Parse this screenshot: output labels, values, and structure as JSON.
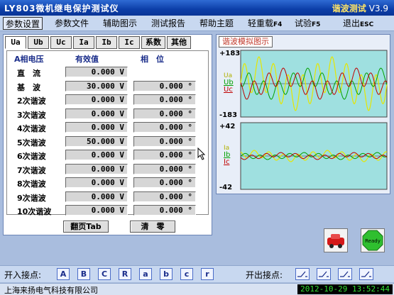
{
  "title": "LY803微机继电保护测试仪",
  "mode": "谐波测试",
  "version": "V3.9",
  "menu": [
    {
      "label": "参数设置",
      "key": ""
    },
    {
      "label": "参数文件",
      "key": ""
    },
    {
      "label": "辅助图示",
      "key": ""
    },
    {
      "label": "测试报告",
      "key": ""
    },
    {
      "label": "帮助主题",
      "key": ""
    },
    {
      "label": "轻重载",
      "key": "F4"
    },
    {
      "label": "试验",
      "key": "F5"
    },
    {
      "label": "退出",
      "key": "ESC"
    }
  ],
  "tabs": [
    "Ua",
    "Ub",
    "Uc",
    "Ia",
    "Ib",
    "Ic",
    "系数",
    "其他"
  ],
  "table": {
    "col_name": "A相电压",
    "col_value": "有效值",
    "col_phase": "相　位",
    "rows": [
      {
        "label": "直　流",
        "value": "0.000 V",
        "phase": ""
      },
      {
        "label": "基　波",
        "value": "30.000 V",
        "phase": "0.000 °"
      },
      {
        "label": "2次谐波",
        "value": "0.000 V",
        "phase": "0.000 °"
      },
      {
        "label": "3次谐波",
        "value": "0.000 V",
        "phase": "0.000 °"
      },
      {
        "label": "4次谐波",
        "value": "0.000 V",
        "phase": "0.000 °"
      },
      {
        "label": "5次谐波",
        "value": "50.000 V",
        "phase": "0.000 °"
      },
      {
        "label": "6次谐波",
        "value": "0.000 V",
        "phase": "0.000 °"
      },
      {
        "label": "7次谐波",
        "value": "0.000 V",
        "phase": "0.000 °"
      },
      {
        "label": "8次谐波",
        "value": "0.000 V",
        "phase": "0.000 °"
      },
      {
        "label": "9次谐波",
        "value": "0.000 V",
        "phase": "0.000 °"
      },
      {
        "label": "10次谐波",
        "value": "0.000 V",
        "phase": "0.000 °"
      }
    ]
  },
  "buttons": {
    "page_turn": "翻页Tab",
    "clear": "清　零"
  },
  "wave": {
    "tab": "谐波模拟图示",
    "voltage": {
      "max": "+183",
      "min": "-183",
      "labels": [
        "Ua",
        "Ub",
        "Uc"
      ]
    },
    "current": {
      "max": "+42",
      "min": "-42",
      "labels": [
        "Ia",
        "Ib",
        "Ic"
      ]
    }
  },
  "bottom": {
    "in_label": "开入接点:",
    "inputs": [
      "A",
      "B",
      "C",
      "R",
      "a",
      "b",
      "c",
      "r"
    ],
    "out_label": "开出接点:",
    "outputs": 4
  },
  "status": {
    "company": "上海来扬电气科技有限公司",
    "datetime": "2012-10-29  13:52:44"
  },
  "colors": {
    "Ua": "#d8d800",
    "Ub": "#00a000",
    "Uc": "#c00000",
    "titlebar": "#0c3ea8"
  }
}
